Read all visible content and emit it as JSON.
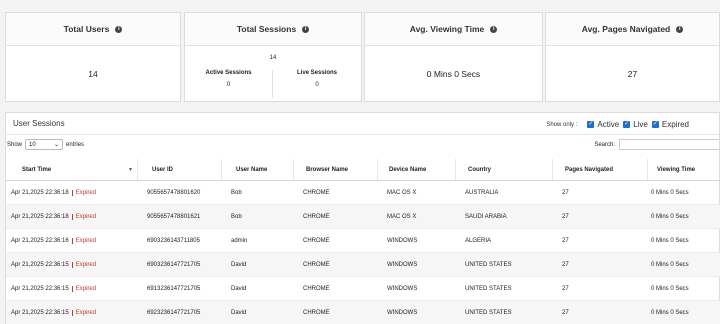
{
  "stats": {
    "total_users": {
      "label": "Total Users",
      "value": "14"
    },
    "total_sessions": {
      "label": "Total Sessions",
      "value": "14",
      "active_label": "Active Sessions",
      "active_value": "0",
      "live_label": "Live Sessions",
      "live_value": "0"
    },
    "avg_viewing_time": {
      "label": "Avg. Viewing Time",
      "value": "0 Mins 0 Secs"
    },
    "avg_pages": {
      "label": "Avg. Pages Navigated",
      "value": "27"
    },
    "info_glyph": "i"
  },
  "sessions": {
    "title": "User Sessions",
    "show_only_label": "Show only :",
    "filters": {
      "active": "Active",
      "live": "Live",
      "expired": "Expired"
    },
    "show_label": "Show",
    "page_size": "10",
    "entries_label": "entries",
    "search_label": "Search:",
    "columns": [
      "Start Time",
      "User ID",
      "User Name",
      "Browser Name",
      "Device Name",
      "Country",
      "Pages Navigated",
      "Viewing Time"
    ],
    "rows": [
      {
        "start": "Apr 21,2025 22:36:18",
        "status": "Expired",
        "user_id": "9055657478801620",
        "user_name": "Bob",
        "browser": "CHROME",
        "device": "MAC OS X",
        "country": "AUSTRALIA",
        "pages": "27",
        "viewing": "0 Mins 0 Secs"
      },
      {
        "start": "Apr 21,2025 22:36:18",
        "status": "Expired",
        "user_id": "9055657478801621",
        "user_name": "Bob",
        "browser": "CHROME",
        "device": "MAC OS X",
        "country": "SAUDI ARABIA",
        "pages": "27",
        "viewing": "0 Mins 0 Secs"
      },
      {
        "start": "Apr 21,2025 22:36:16",
        "status": "Expired",
        "user_id": "6903236143711805",
        "user_name": "admin",
        "browser": "CHROME",
        "device": "WINDOWS",
        "country": "ALGERIA",
        "pages": "27",
        "viewing": "0 Mins 0 Secs"
      },
      {
        "start": "Apr 21,2025 22:36:15",
        "status": "Expired",
        "user_id": "6903236147721705",
        "user_name": "David",
        "browser": "CHROME",
        "device": "WINDOWS",
        "country": "UNITED STATES",
        "pages": "27",
        "viewing": "0 Mins 0 Secs"
      },
      {
        "start": "Apr 21,2025 22:36:15",
        "status": "Expired",
        "user_id": "6913236147721705",
        "user_name": "David",
        "browser": "CHROME",
        "device": "WINDOWS",
        "country": "UNITED STATES",
        "pages": "27",
        "viewing": "0 Mins 0 Secs"
      },
      {
        "start": "Apr 21,2025 22:36:15",
        "status": "Expired",
        "user_id": "6923236147721705",
        "user_name": "David",
        "browser": "CHROME",
        "device": "WINDOWS",
        "country": "UNITED STATES",
        "pages": "27",
        "viewing": "0 Mins 0 Secs"
      }
    ]
  },
  "colors": {
    "accent": "#1a6fd1",
    "expired": "#c0392b"
  }
}
